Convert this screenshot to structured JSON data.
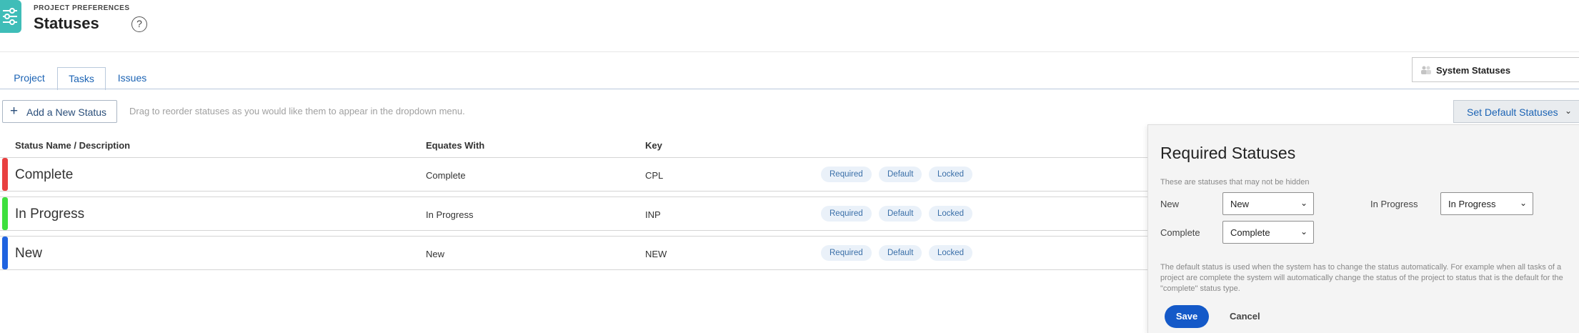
{
  "header": {
    "breadcrumb": "PROJECT PREFERENCES",
    "title": "Statuses",
    "help_icon": "?"
  },
  "tabs": [
    {
      "label": "Project",
      "active": false
    },
    {
      "label": "Tasks",
      "active": true
    },
    {
      "label": "Issues",
      "active": false
    }
  ],
  "system_statuses": {
    "label": "System Statuses",
    "icon": "users-icon"
  },
  "toolbar": {
    "add_label": "Add a New Status",
    "add_icon": "+",
    "hint": "Drag to reorder statuses as you would like them to appear in the dropdown menu.",
    "set_default_label": "Set Default Statuses",
    "set_default_icon": "⌄"
  },
  "table": {
    "columns": [
      "Status Name / Description",
      "Equates With",
      "Key"
    ],
    "rows": [
      {
        "name": "Complete",
        "equates": "Complete",
        "key": "CPL",
        "color": "#e84040",
        "badges": [
          "Required",
          "Default",
          "Locked"
        ]
      },
      {
        "name": "In Progress",
        "equates": "In Progress",
        "key": "INP",
        "color": "#3ee03e",
        "badges": [
          "Required",
          "Default",
          "Locked"
        ]
      },
      {
        "name": "New",
        "equates": "New",
        "key": "NEW",
        "color": "#1f63e0",
        "badges": [
          "Required",
          "Default",
          "Locked"
        ]
      }
    ]
  },
  "popover": {
    "title": "Required Statuses",
    "subtitle": "These are statuses that may not be hidden",
    "fields": {
      "new_label": "New",
      "new_value": "New",
      "in_progress_label": "In Progress",
      "in_progress_value": "In Progress",
      "complete_label": "Complete",
      "complete_value": "Complete"
    },
    "note": "The default status is used when the system has to change the status automatically. For example when all tasks of a project are complete the system will automatically change the status of the project to status that is the default for the \"complete\" status type.",
    "save_label": "Save",
    "cancel_label": "Cancel"
  },
  "colors": {
    "accent": "#1b63b4",
    "app_icon": "#3fbdb8",
    "save_button": "#1459c8"
  }
}
